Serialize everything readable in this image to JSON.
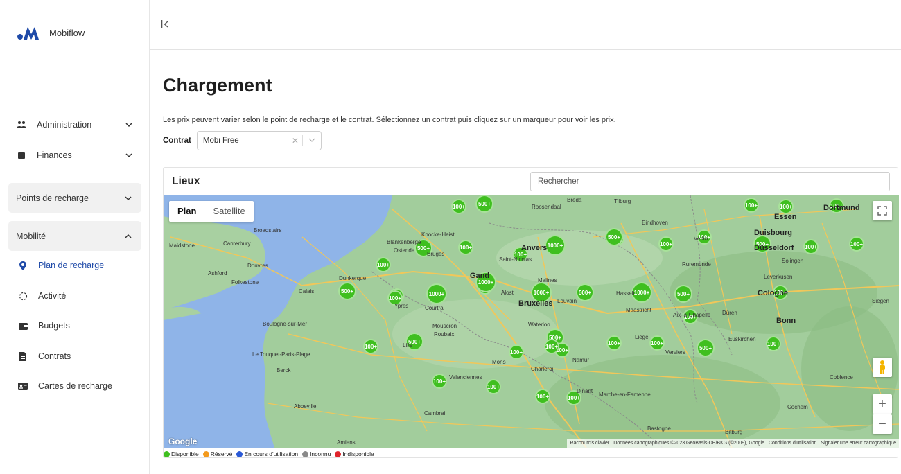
{
  "brand": {
    "name": "Mobiflow"
  },
  "sidebar": {
    "administration": "Administration",
    "finances": "Finances",
    "points_de_recharge": "Points de recharge",
    "mobilite": "Mobilité",
    "sub_items": [
      {
        "label": "Plan de recharge",
        "icon": "map-pin-icon"
      },
      {
        "label": "Activité",
        "icon": "activity-icon"
      },
      {
        "label": "Budgets",
        "icon": "wallet-icon"
      },
      {
        "label": "Contrats",
        "icon": "document-icon"
      },
      {
        "label": "Cartes de recharge",
        "icon": "id-card-icon"
      }
    ]
  },
  "main": {
    "title": "Chargement",
    "info": "Les prix peuvent varier selon le point de recharge et le contrat. Sélectionnez un contrat puis cliquez sur un marqueur pour voir les prix.",
    "contract_label": "Contrat",
    "contract_value": "Mobi Free"
  },
  "locations": {
    "title": "Lieux",
    "search_placeholder": "Rechercher"
  },
  "map": {
    "plan": "Plan",
    "satellite": "Satellite",
    "google": "Google",
    "attrib": [
      "Raccourcis clavier",
      "Données cartographiques ©2023 GeoBasis-DE/BKG (©2009), Google",
      "Conditions d'utilisation",
      "Signaler une erreur cartographique"
    ],
    "clusters": [
      "100+",
      "500+",
      "500+",
      "1000+",
      "100+",
      "100+",
      "100+",
      "500+",
      "100+",
      "100+",
      "500+",
      "1000+",
      "500+",
      "100+",
      "100+",
      "100+",
      "500+",
      "100+",
      "1000+",
      "100+",
      "100+",
      "1000+",
      "100+",
      "1000+",
      "500+",
      "100+",
      "500+",
      "1000+",
      "100+",
      "500+",
      "100+",
      "100+",
      "100+",
      "100+",
      "100+",
      "100+",
      "500+",
      "100+",
      "100+",
      "100+",
      "100+",
      "100+",
      "100+",
      "100+",
      "100+",
      "100+"
    ],
    "cities": [
      "Maidstone",
      "Canterbury",
      "Broadstairs",
      "Ashford",
      "Folkestone",
      "Douvres",
      "Calais",
      "Dunkerque",
      "Boulogne-sur-Mer",
      "Le Touquet-Paris-Plage",
      "Berck",
      "Abbeville",
      "Amiens",
      "Knocke-Heist",
      "Blankenberge",
      "Ostende",
      "Bruges",
      "Gand",
      "Ypres",
      "Courtrai",
      "Roubaix",
      "Mouscron",
      "Lille",
      "Valenciennes",
      "Cambrai",
      "Mons",
      "Charleroi",
      "Namur",
      "Waterloo",
      "Bruxelles",
      "Louvain",
      "Malines",
      "Alost",
      "Anvers",
      "Saint-Nicolas",
      "Breda",
      "Tilburg",
      "Roosendaal",
      "Eindhoven",
      "Venlo",
      "Ruremonde",
      "Hasselt",
      "Maastricht",
      "Liège",
      "Verviers",
      "Aix-la-Chapelle",
      "Düren",
      "Cologne",
      "Bonn",
      "Siegen",
      "Euskirchen",
      "Coblence",
      "Cochem",
      "Bitburg",
      "Bastogne",
      "Marche-en-Famenne",
      "Dinant",
      "Duisbourg",
      "Essen",
      "Dortmund",
      "Düsseldorf",
      "Solingen",
      "Leverkusen"
    ],
    "big_cities": [
      "Bruxelles",
      "Gand",
      "Anvers",
      "Cologne",
      "Bonn",
      "Duisbourg",
      "Essen",
      "Dortmund",
      "Düsseldorf"
    ]
  },
  "legend": [
    {
      "label": "Disponible",
      "color": "#3fbf1f"
    },
    {
      "label": "Réservé",
      "color": "#f39a1d"
    },
    {
      "label": "En cours d'utilisation",
      "color": "#2a59d6"
    },
    {
      "label": "Inconnu",
      "color": "#8a8a8a"
    },
    {
      "label": "Indisponible",
      "color": "#e0242b"
    }
  ]
}
